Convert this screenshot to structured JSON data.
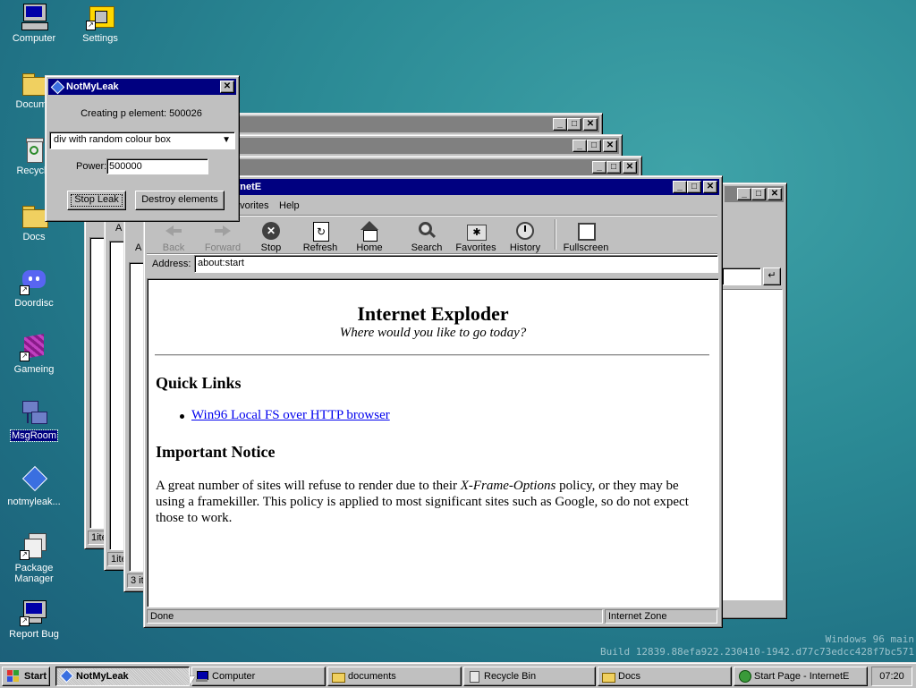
{
  "desktop": {
    "icons": [
      {
        "label": "Computer"
      },
      {
        "label": "Settings"
      },
      {
        "label": "Docume"
      },
      {
        "label": "Recycle"
      },
      {
        "label": "Docs"
      },
      {
        "label": "Doordisc"
      },
      {
        "label": "Gameing"
      },
      {
        "label": "MsgRoom"
      },
      {
        "label": "notmyleak..."
      },
      {
        "label": "Package Manager"
      },
      {
        "label": "Report Bug"
      }
    ],
    "watermark": {
      "line1": "Windows 96 main",
      "line2": "Build 12839.88efa922.230410-1942.d77c73edcc428f7bc571"
    }
  },
  "notmyleak": {
    "title": "NotMyLeak",
    "status": "Creating p element: 500026",
    "mode_selected": "div with random colour box",
    "power_label": "Power:",
    "power_value": "500000",
    "stop_label": "Stop Leak",
    "destroy_label": "Destroy elements"
  },
  "ie": {
    "title_partial": "rnetE",
    "menu": [
      "avorites",
      "Help"
    ],
    "toolbar": [
      {
        "label": "Back"
      },
      {
        "label": "Forward"
      },
      {
        "label": "Stop"
      },
      {
        "label": "Refresh"
      },
      {
        "label": "Home"
      },
      {
        "label": "Search"
      },
      {
        "label": "Favorites"
      },
      {
        "label": "History"
      },
      {
        "label": "Fullscreen"
      }
    ],
    "address_label": "Address:",
    "address_value": "about:start",
    "page": {
      "heading": "Internet Exploder",
      "tagline": "Where would you like to go today?",
      "quick_links_heading": "Quick Links",
      "link1": "Win96 Local FS over HTTP browser",
      "notice_heading": "Important Notice",
      "notice_p1": "A great number of sites will refuse to render due to their ",
      "notice_em": "X-Frame-Options",
      "notice_p2": " policy, or they may be using a framekiller. This policy is applied to most significant sites such as Google, so do not expect those to work."
    },
    "status_left": "Done",
    "status_zone": "Internet Zone"
  },
  "bg_windows": {
    "explorer_status": [
      "1ite",
      "1ite",
      "3 ite"
    ],
    "explorer_toolbar": [
      "A",
      "A",
      "A"
    ]
  },
  "taskbar": {
    "start": "Start",
    "items": [
      {
        "label": "NotMyLeak"
      },
      {
        "label": "Computer"
      },
      {
        "label": "documents"
      },
      {
        "label": "Recycle Bin"
      },
      {
        "label": "Docs"
      },
      {
        "label": "Start Page - InternetE"
      }
    ],
    "clock": "07:20"
  }
}
